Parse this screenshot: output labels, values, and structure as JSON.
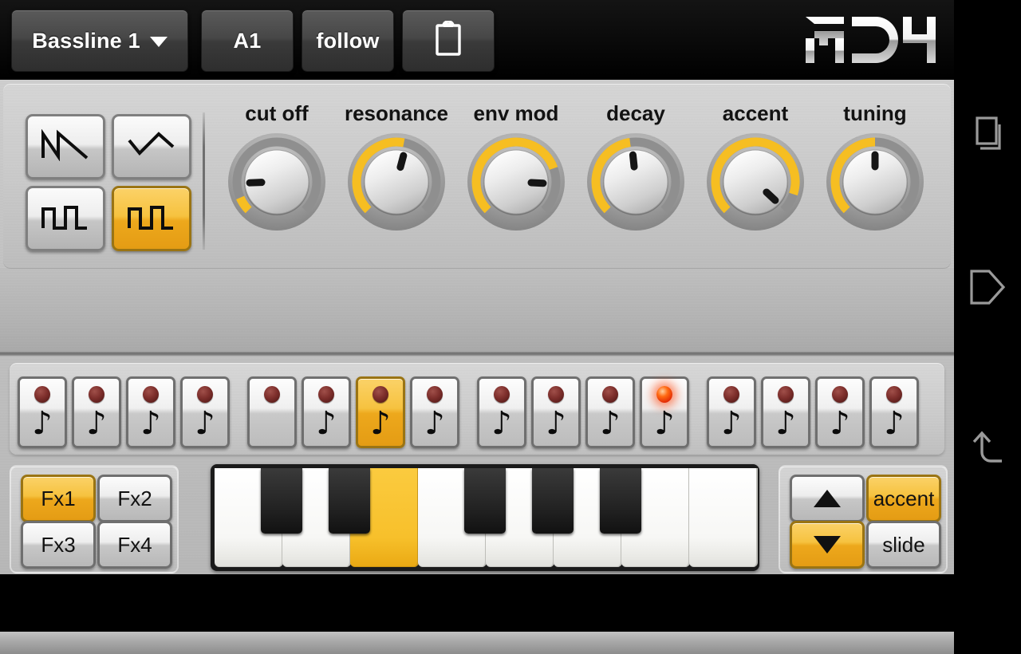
{
  "app": {
    "logo": "RD4"
  },
  "header": {
    "pattern_button": {
      "label": "Bassline 1",
      "icon": "chevron-down-icon"
    },
    "key_button": {
      "label": "A1"
    },
    "follow_button": {
      "label": "follow"
    },
    "clipboard_button": {
      "label": "",
      "icon": "clipboard-icon"
    }
  },
  "colors": {
    "accent_amber": "#F6C23F",
    "accent_amber_dark": "#E49C14",
    "panel_grey": "#C6C6C6",
    "header_black": "#141414",
    "led_off": "#7E2F2C",
    "led_on": "#FF6A12"
  },
  "oscillator": {
    "waveforms": [
      {
        "name": "sawtooth",
        "icon": "sawtooth-wave-icon",
        "active": false
      },
      {
        "name": "triangle",
        "icon": "triangle-wave-icon",
        "active": false
      },
      {
        "name": "square",
        "icon": "square-wave-icon",
        "active": false
      },
      {
        "name": "pulse",
        "icon": "pulse-wave-icon",
        "active": true
      }
    ]
  },
  "knobs": [
    {
      "label": "cut off",
      "value": 8,
      "angle": -92
    },
    {
      "label": "resonance",
      "value": 54,
      "angle": 15
    },
    {
      "label": "env mod",
      "value": 76,
      "angle": 93
    },
    {
      "label": "decay",
      "value": 47,
      "angle": -6
    },
    {
      "label": "accent",
      "value": 90,
      "angle": 133
    },
    {
      "label": "tuning",
      "value": 50,
      "angle": 0
    }
  ],
  "sequencer": {
    "step_count": 16,
    "note_glyph": "♪",
    "steps": [
      {
        "index": 1,
        "note": true,
        "selected": false,
        "led": "off"
      },
      {
        "index": 2,
        "note": true,
        "selected": false,
        "led": "off"
      },
      {
        "index": 3,
        "note": true,
        "selected": false,
        "led": "off"
      },
      {
        "index": 4,
        "note": true,
        "selected": false,
        "led": "off"
      },
      {
        "index": 5,
        "note": false,
        "selected": false,
        "led": "off"
      },
      {
        "index": 6,
        "note": true,
        "selected": false,
        "led": "off"
      },
      {
        "index": 7,
        "note": true,
        "selected": true,
        "led": "off"
      },
      {
        "index": 8,
        "note": true,
        "selected": false,
        "led": "off"
      },
      {
        "index": 9,
        "note": true,
        "selected": false,
        "led": "off"
      },
      {
        "index": 10,
        "note": true,
        "selected": false,
        "led": "off"
      },
      {
        "index": 11,
        "note": true,
        "selected": false,
        "led": "off"
      },
      {
        "index": 12,
        "note": true,
        "selected": false,
        "led": "on"
      },
      {
        "index": 13,
        "note": true,
        "selected": false,
        "led": "off"
      },
      {
        "index": 14,
        "note": true,
        "selected": false,
        "led": "off"
      },
      {
        "index": 15,
        "note": true,
        "selected": false,
        "led": "off"
      },
      {
        "index": 16,
        "note": true,
        "selected": false,
        "led": "off"
      }
    ]
  },
  "fx": [
    {
      "label": "Fx1",
      "active": true
    },
    {
      "label": "Fx2",
      "active": false
    },
    {
      "label": "Fx3",
      "active": false
    },
    {
      "label": "Fx4",
      "active": false
    }
  ],
  "transport": [
    {
      "label": "",
      "icon": "arrow-up-icon",
      "active": false
    },
    {
      "label": "accent",
      "icon": "",
      "active": true
    },
    {
      "label": "",
      "icon": "arrow-down-icon",
      "active": true
    },
    {
      "label": "slide",
      "icon": "",
      "active": false
    }
  ],
  "keyboard": {
    "white_keys": [
      {
        "note": "C",
        "active": false
      },
      {
        "note": "D",
        "active": false
      },
      {
        "note": "E",
        "active": true
      },
      {
        "note": "F",
        "active": false
      },
      {
        "note": "G",
        "active": false
      },
      {
        "note": "A",
        "active": false
      },
      {
        "note": "B",
        "active": false
      },
      {
        "note": "C",
        "active": false
      }
    ],
    "black_keys": [
      {
        "note": "C#",
        "active": false
      },
      {
        "note": "D#",
        "active": false
      },
      {
        "note": "F#",
        "active": false
      },
      {
        "note": "G#",
        "active": false
      },
      {
        "note": "A#",
        "active": false
      }
    ]
  },
  "navbar": [
    {
      "name": "recents",
      "icon": "recents-icon"
    },
    {
      "name": "home",
      "icon": "home-icon"
    },
    {
      "name": "back",
      "icon": "back-icon"
    }
  ]
}
